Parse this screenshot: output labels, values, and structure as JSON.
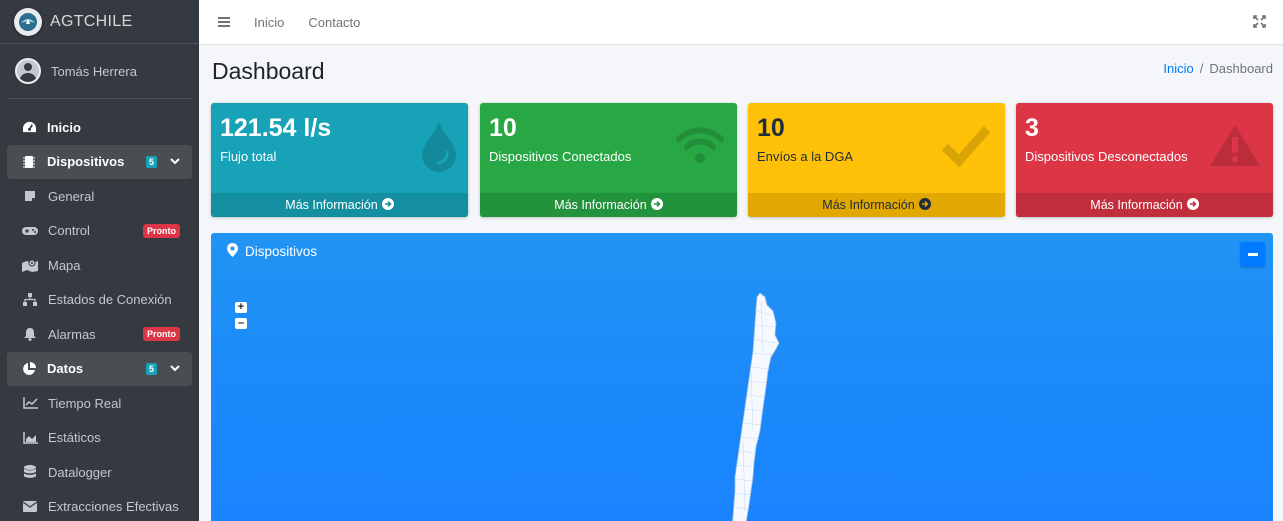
{
  "brand": {
    "name": "AGTCHILE",
    "logo_icon": "agt-logo-icon"
  },
  "user": {
    "name": "Tomás Herrera"
  },
  "sidebar": {
    "items": [
      {
        "label": "Inicio",
        "icon": "tachometer-icon"
      },
      {
        "label": "Dispositivos",
        "icon": "chip-icon",
        "badge": "5"
      },
      {
        "label": "General",
        "icon": "sticky-note-icon"
      },
      {
        "label": "Control",
        "icon": "gamepad-icon",
        "badge": "Pronto"
      },
      {
        "label": "Mapa",
        "icon": "map-icon"
      },
      {
        "label": "Estados de Conexión",
        "icon": "network-icon"
      },
      {
        "label": "Alarmas",
        "icon": "bell-icon",
        "badge": "Pronto"
      },
      {
        "label": "Datos",
        "icon": "pie-chart-icon",
        "badge": "5"
      },
      {
        "label": "Tiempo Real",
        "icon": "line-chart-icon"
      },
      {
        "label": "Estáticos",
        "icon": "area-chart-icon"
      },
      {
        "label": "Datalogger",
        "icon": "database-icon"
      },
      {
        "label": "Extracciones Efectivas",
        "icon": "envelope-icon"
      }
    ]
  },
  "topbar": {
    "links": [
      "Inicio",
      "Contacto"
    ]
  },
  "page": {
    "title": "Dashboard"
  },
  "breadcrumb": {
    "home": "Inicio",
    "separator": "/",
    "current": "Dashboard"
  },
  "boxes": [
    {
      "value": "121.54 l/s",
      "label": "Flujo total",
      "more": "Más Información",
      "icon": "water-drop-icon",
      "color": "#17a2b8"
    },
    {
      "value": "10",
      "label": "Dispositivos Conectados",
      "more": "Más Información",
      "icon": "wifi-icon",
      "color": "#28a745"
    },
    {
      "value": "10",
      "label": "Envíos a la DGA",
      "more": "Más Información",
      "icon": "check-icon",
      "color": "#ffc107"
    },
    {
      "value": "3",
      "label": "Dispositivos Desconectados",
      "more": "Más Información",
      "icon": "warning-icon",
      "color": "#dc3545"
    }
  ],
  "map": {
    "title": "Dispositivos",
    "zoom_in": "+",
    "zoom_out": "–",
    "color": "#1a87fb"
  }
}
